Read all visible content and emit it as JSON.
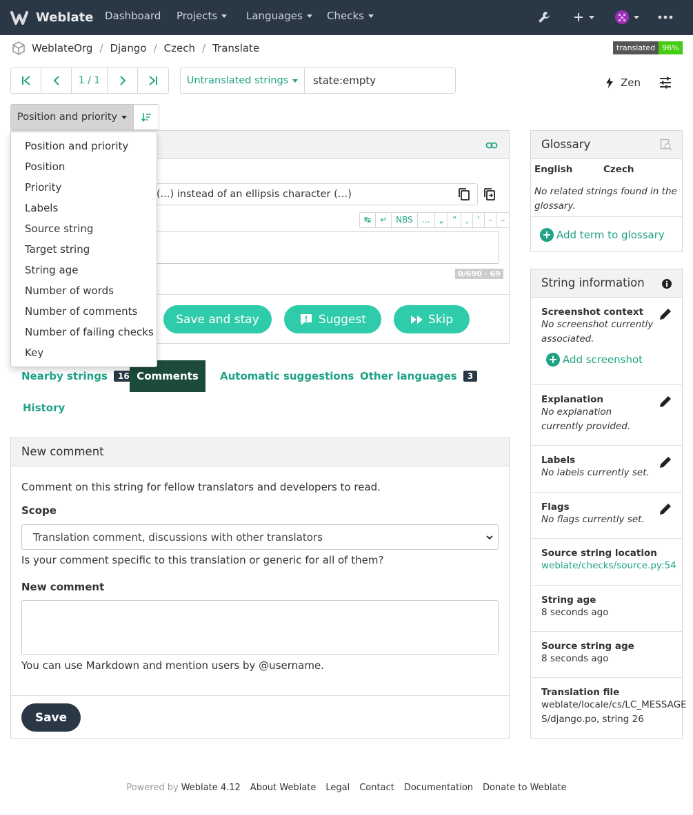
{
  "navbar": {
    "brand": "Weblate",
    "links": [
      "Dashboard",
      "Projects",
      "Languages",
      "Checks"
    ]
  },
  "breadcrumb": [
    "WeblateOrg",
    "Django",
    "Czech",
    "Translate"
  ],
  "badge": {
    "label": "translated",
    "value": "96%"
  },
  "pager": {
    "position": "1 / 1"
  },
  "filter": {
    "select": "Untranslated strings",
    "query": "state:empty"
  },
  "zen_label": "Zen",
  "sort": {
    "selected": "Position and priority"
  },
  "sort_options": [
    "Position and priority",
    "Position",
    "Priority",
    "Labels",
    "Source string",
    "Target string",
    "String age",
    "Number of words",
    "Number of comments",
    "Number of failing checks",
    "Key"
  ],
  "translation": {
    "source_fragment": "(...) instead of an ellipsis character (…)",
    "specials": [
      "↹",
      "↵",
      "NBS",
      "…",
      "„",
      "“",
      "‚",
      "‘",
      "-",
      "–"
    ],
    "counter": "0/690 · 69",
    "buttons": {
      "save_stay": "Save and stay",
      "suggest": "Suggest",
      "skip": "Skip"
    }
  },
  "tabs": [
    {
      "label": "Nearby strings",
      "count": "16"
    },
    {
      "label": "Comments"
    },
    {
      "label": "Automatic suggestions"
    },
    {
      "label": "Other languages",
      "count": "3"
    },
    {
      "label": "History"
    }
  ],
  "comment": {
    "title": "New comment",
    "intro": "Comment on this string for fellow translators and developers to read.",
    "scope_label": "Scope",
    "scope_value": "Translation comment, discussions with other translators",
    "scope_help": "Is your comment specific to this translation or generic for all of them?",
    "new_label": "New comment",
    "markdown_help": "You can use Markdown and mention users by @username.",
    "save": "Save"
  },
  "glossary": {
    "title": "Glossary",
    "col_source": "English",
    "col_target": "Czech",
    "empty": "No related strings found in the glossary.",
    "add": "Add term to glossary"
  },
  "info": {
    "title": "String information",
    "screenshot_title": "Screenshot context",
    "screenshot_value": "No screenshot currently associated.",
    "add_screenshot": "Add screenshot",
    "explanation_title": "Explanation",
    "explanation_value": "No explanation currently provided.",
    "labels_title": "Labels",
    "labels_value": "No labels currently set.",
    "flags_title": "Flags",
    "flags_value": "No flags currently set.",
    "location_title": "Source string location",
    "location_value": "weblate/checks/source.py:54",
    "age_title": "String age",
    "age_value": "8 seconds ago",
    "src_age_title": "Source string age",
    "src_age_value": "8 seconds ago",
    "file_title": "Translation file",
    "file_value_1": "weblate/locale/cs/LC_MESSAGE",
    "file_value_2": "S/django.po, string 26"
  },
  "footer": {
    "powered": "Powered by",
    "version": "Weblate 4.12",
    "links": [
      "About Weblate",
      "Legal",
      "Contact",
      "Documentation",
      "Donate to Weblate"
    ]
  },
  "colors": {
    "accent": "#1fa385",
    "navbar": "#2a3744",
    "button": "#2eccaa",
    "active_tab": "#1c4a3b"
  }
}
